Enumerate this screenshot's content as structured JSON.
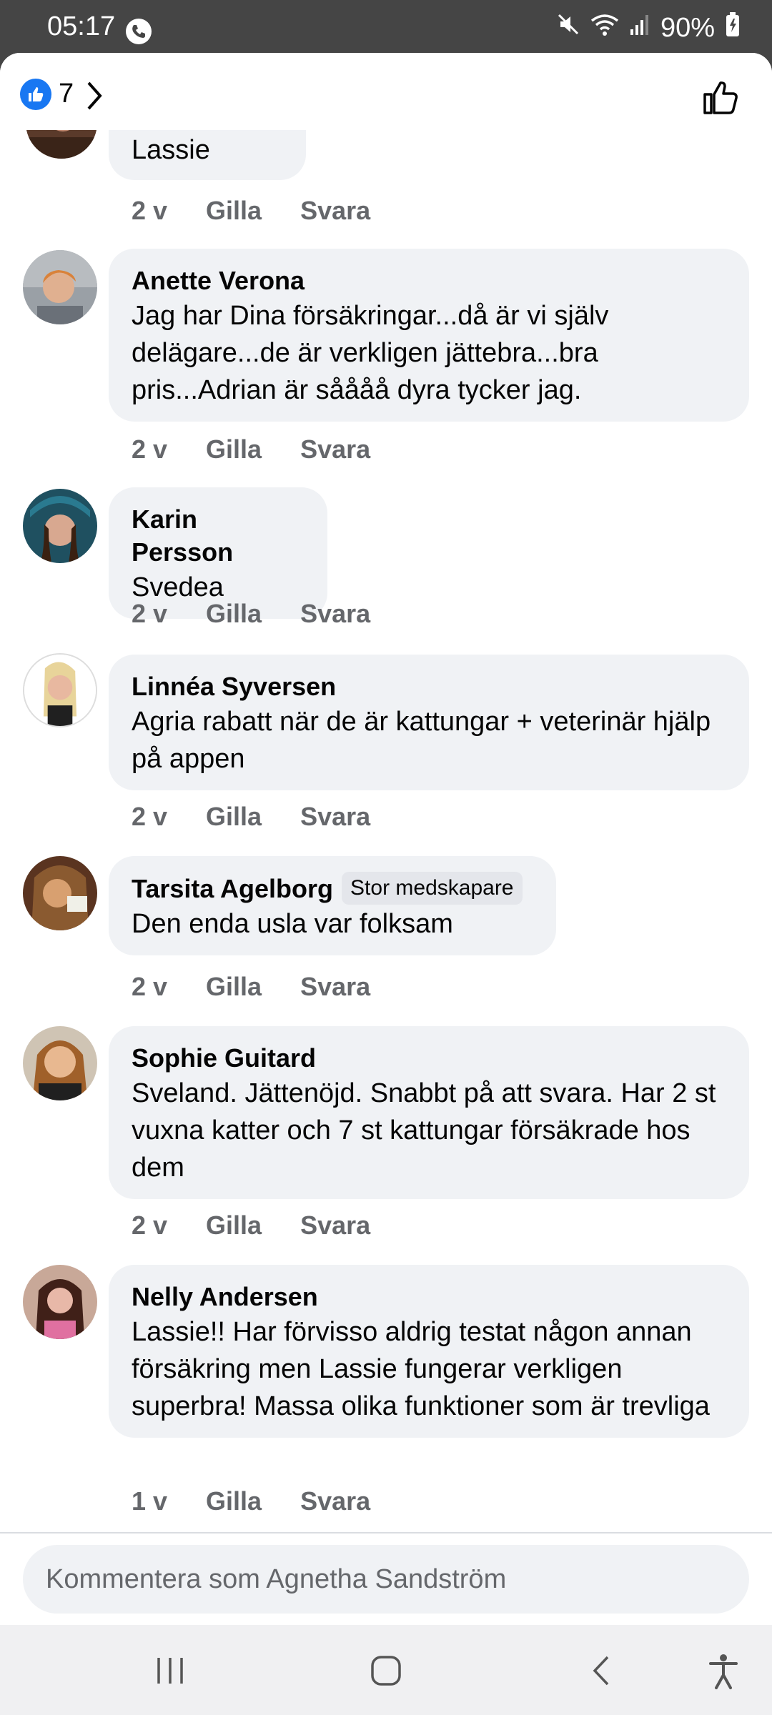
{
  "status_bar": {
    "time": "05:17",
    "battery": "90%",
    "icons": [
      "call-icon",
      "mute-icon",
      "wifi-icon",
      "signal-icon",
      "battery-icon"
    ]
  },
  "header": {
    "like_count": "7"
  },
  "comments": [
    {
      "author": "",
      "text": "Lassie",
      "time": "2 v",
      "like": "Gilla",
      "reply": "Svara"
    },
    {
      "author": "Anette Verona",
      "text": "Jag har Dina försäkringar...då är vi själv delägare...de är verkligen jättebra...bra pris...Adrian är såååå dyra tycker jag.",
      "time": "2 v",
      "like": "Gilla",
      "reply": "Svara"
    },
    {
      "author": "Karin Persson",
      "text": "Svedea",
      "time": "2 v",
      "like": "Gilla",
      "reply": "Svara"
    },
    {
      "author": "Linnéa Syversen",
      "text": "Agria rabatt när de är kattungar + veterinär hjälp på appen",
      "time": "2 v",
      "like": "Gilla",
      "reply": "Svara"
    },
    {
      "author": "Tarsita Agelborg",
      "badge": "Stor medskapare",
      "text": "Den enda usla var folksam",
      "time": "2 v",
      "like": "Gilla",
      "reply": "Svara"
    },
    {
      "author": "Sophie Guitard",
      "text": "Sveland. Jättenöjd. Snabbt på att svara. Har 2 st vuxna katter och 7 st kattungar försäkrade hos dem",
      "time": "2 v",
      "like": "Gilla",
      "reply": "Svara"
    },
    {
      "author": "Nelly Andersen",
      "text": "Lassie!! Har förvisso aldrig testat någon annan försäkring men Lassie fungerar verkligen superbra! Massa olika funktioner som är trevliga",
      "time": "1 v",
      "like": "Gilla",
      "reply": "Svara"
    }
  ],
  "composer": {
    "placeholder": "Kommentera som Agnetha Sandström"
  },
  "colors": {
    "accent": "#1877f2",
    "bubble": "#f0f2f5",
    "meta_text": "#65676b"
  }
}
